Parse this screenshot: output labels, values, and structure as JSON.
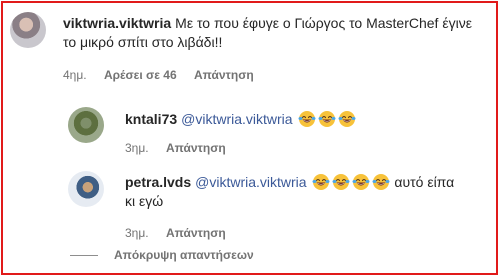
{
  "comment": {
    "username": "viktwria.viktwria",
    "text": "Με το που έφυγε ο Γιώργος το MasterChef έγινε το μικρό σπίτι στο λιβάδι!!",
    "time": "4ημ.",
    "likes": "Αρέσει σε 46",
    "reply_label": "Απάντηση"
  },
  "replies": [
    {
      "username": "kntali73",
      "mention": "@viktwria.viktwria",
      "emoji_count": 3,
      "emoji": "grinning-tears-emoji",
      "text_after": "",
      "time": "3ημ.",
      "reply_label": "Απάντηση"
    },
    {
      "username": "petra.lvds",
      "mention": "@viktwria.viktwria",
      "emoji_count": 4,
      "emoji": "grinning-tears-emoji",
      "text_after": "αυτό είπα κι εγώ",
      "time": "3ημ.",
      "reply_label": "Απάντηση"
    }
  ],
  "hide_replies_label": "Απόκρυψη απαντήσεων",
  "colors": {
    "frame": "#e11a1a",
    "mention": "#3b5998",
    "meta": "#737373"
  }
}
